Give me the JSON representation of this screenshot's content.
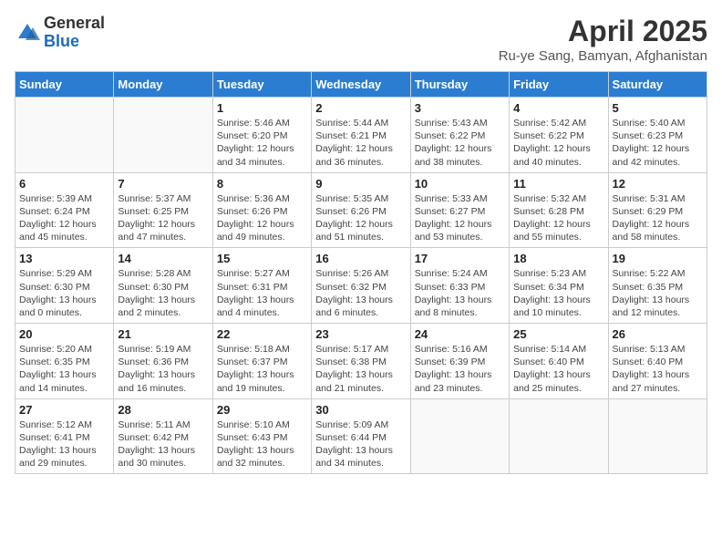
{
  "header": {
    "logo_general": "General",
    "logo_blue": "Blue",
    "title": "April 2025",
    "subtitle": "Ru-ye Sang, Bamyan, Afghanistan"
  },
  "days_of_week": [
    "Sunday",
    "Monday",
    "Tuesday",
    "Wednesday",
    "Thursday",
    "Friday",
    "Saturday"
  ],
  "weeks": [
    [
      {
        "day": "",
        "info": ""
      },
      {
        "day": "",
        "info": ""
      },
      {
        "day": "1",
        "info": "Sunrise: 5:46 AM\nSunset: 6:20 PM\nDaylight: 12 hours and 34 minutes."
      },
      {
        "day": "2",
        "info": "Sunrise: 5:44 AM\nSunset: 6:21 PM\nDaylight: 12 hours and 36 minutes."
      },
      {
        "day": "3",
        "info": "Sunrise: 5:43 AM\nSunset: 6:22 PM\nDaylight: 12 hours and 38 minutes."
      },
      {
        "day": "4",
        "info": "Sunrise: 5:42 AM\nSunset: 6:22 PM\nDaylight: 12 hours and 40 minutes."
      },
      {
        "day": "5",
        "info": "Sunrise: 5:40 AM\nSunset: 6:23 PM\nDaylight: 12 hours and 42 minutes."
      }
    ],
    [
      {
        "day": "6",
        "info": "Sunrise: 5:39 AM\nSunset: 6:24 PM\nDaylight: 12 hours and 45 minutes."
      },
      {
        "day": "7",
        "info": "Sunrise: 5:37 AM\nSunset: 6:25 PM\nDaylight: 12 hours and 47 minutes."
      },
      {
        "day": "8",
        "info": "Sunrise: 5:36 AM\nSunset: 6:26 PM\nDaylight: 12 hours and 49 minutes."
      },
      {
        "day": "9",
        "info": "Sunrise: 5:35 AM\nSunset: 6:26 PM\nDaylight: 12 hours and 51 minutes."
      },
      {
        "day": "10",
        "info": "Sunrise: 5:33 AM\nSunset: 6:27 PM\nDaylight: 12 hours and 53 minutes."
      },
      {
        "day": "11",
        "info": "Sunrise: 5:32 AM\nSunset: 6:28 PM\nDaylight: 12 hours and 55 minutes."
      },
      {
        "day": "12",
        "info": "Sunrise: 5:31 AM\nSunset: 6:29 PM\nDaylight: 12 hours and 58 minutes."
      }
    ],
    [
      {
        "day": "13",
        "info": "Sunrise: 5:29 AM\nSunset: 6:30 PM\nDaylight: 13 hours and 0 minutes."
      },
      {
        "day": "14",
        "info": "Sunrise: 5:28 AM\nSunset: 6:30 PM\nDaylight: 13 hours and 2 minutes."
      },
      {
        "day": "15",
        "info": "Sunrise: 5:27 AM\nSunset: 6:31 PM\nDaylight: 13 hours and 4 minutes."
      },
      {
        "day": "16",
        "info": "Sunrise: 5:26 AM\nSunset: 6:32 PM\nDaylight: 13 hours and 6 minutes."
      },
      {
        "day": "17",
        "info": "Sunrise: 5:24 AM\nSunset: 6:33 PM\nDaylight: 13 hours and 8 minutes."
      },
      {
        "day": "18",
        "info": "Sunrise: 5:23 AM\nSunset: 6:34 PM\nDaylight: 13 hours and 10 minutes."
      },
      {
        "day": "19",
        "info": "Sunrise: 5:22 AM\nSunset: 6:35 PM\nDaylight: 13 hours and 12 minutes."
      }
    ],
    [
      {
        "day": "20",
        "info": "Sunrise: 5:20 AM\nSunset: 6:35 PM\nDaylight: 13 hours and 14 minutes."
      },
      {
        "day": "21",
        "info": "Sunrise: 5:19 AM\nSunset: 6:36 PM\nDaylight: 13 hours and 16 minutes."
      },
      {
        "day": "22",
        "info": "Sunrise: 5:18 AM\nSunset: 6:37 PM\nDaylight: 13 hours and 19 minutes."
      },
      {
        "day": "23",
        "info": "Sunrise: 5:17 AM\nSunset: 6:38 PM\nDaylight: 13 hours and 21 minutes."
      },
      {
        "day": "24",
        "info": "Sunrise: 5:16 AM\nSunset: 6:39 PM\nDaylight: 13 hours and 23 minutes."
      },
      {
        "day": "25",
        "info": "Sunrise: 5:14 AM\nSunset: 6:40 PM\nDaylight: 13 hours and 25 minutes."
      },
      {
        "day": "26",
        "info": "Sunrise: 5:13 AM\nSunset: 6:40 PM\nDaylight: 13 hours and 27 minutes."
      }
    ],
    [
      {
        "day": "27",
        "info": "Sunrise: 5:12 AM\nSunset: 6:41 PM\nDaylight: 13 hours and 29 minutes."
      },
      {
        "day": "28",
        "info": "Sunrise: 5:11 AM\nSunset: 6:42 PM\nDaylight: 13 hours and 30 minutes."
      },
      {
        "day": "29",
        "info": "Sunrise: 5:10 AM\nSunset: 6:43 PM\nDaylight: 13 hours and 32 minutes."
      },
      {
        "day": "30",
        "info": "Sunrise: 5:09 AM\nSunset: 6:44 PM\nDaylight: 13 hours and 34 minutes."
      },
      {
        "day": "",
        "info": ""
      },
      {
        "day": "",
        "info": ""
      },
      {
        "day": "",
        "info": ""
      }
    ]
  ]
}
